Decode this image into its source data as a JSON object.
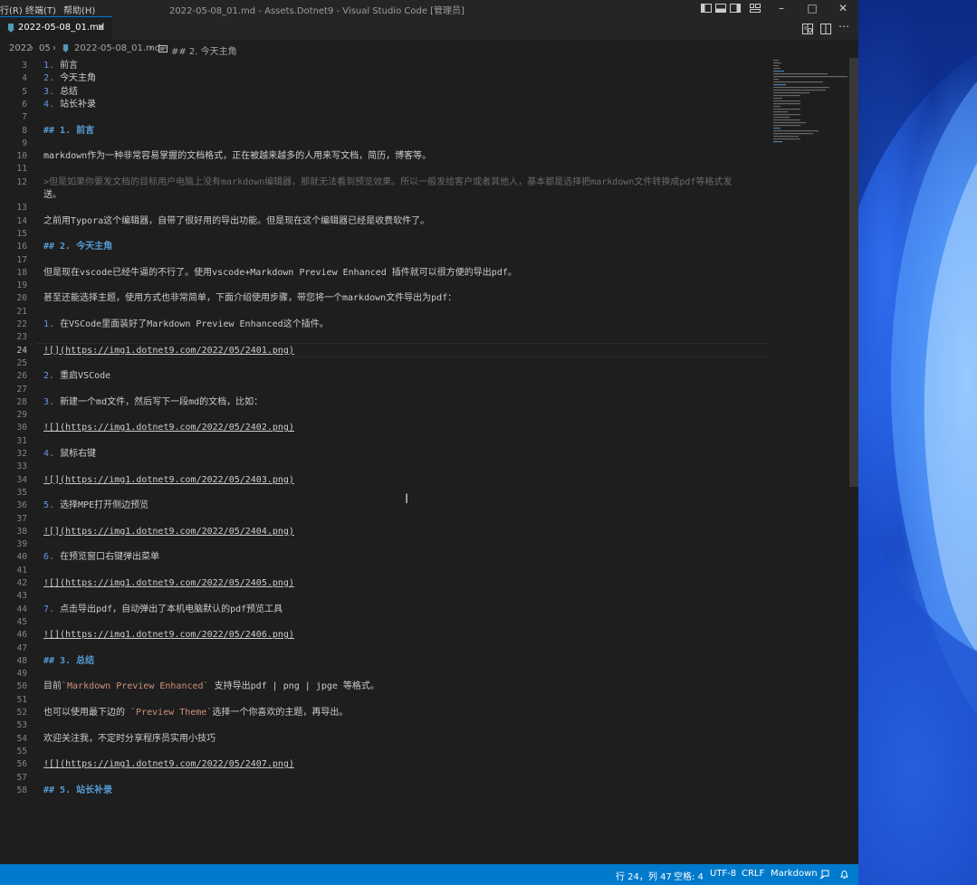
{
  "window": {
    "title": "2022-05-08_01.md - Assets.Dotnet9 - Visual Studio Code [管理员]",
    "menu": [
      "行(R)",
      "终端(T)",
      "帮助(H)"
    ]
  },
  "tab": {
    "label": "2022-05-08_01.md",
    "icon": "markdown-icon"
  },
  "breadcrumb": [
    "2022",
    "05",
    "2022-05-08_01.md",
    "## 2. 今天主角"
  ],
  "editor": {
    "current_line": 24,
    "lines": [
      {
        "n": "3",
        "t": "1. 前言"
      },
      {
        "n": "4",
        "t": "2. 今天主角"
      },
      {
        "n": "5",
        "t": "3. 总结"
      },
      {
        "n": "6",
        "t": "4. 站长补录"
      },
      {
        "n": "7",
        "t": ""
      },
      {
        "n": "8",
        "t": "## 1. 前言"
      },
      {
        "n": "9",
        "t": ""
      },
      {
        "n": "10",
        "t": "markdown作为一种非常容易掌握的文档格式，正在被越来越多的人用来写文档，简历，博客等。"
      },
      {
        "n": "11",
        "t": ""
      },
      {
        "n": "12",
        "t": ">但是如果你要发文档的目标用户电脑上没有markdown编辑器，那就无法看到预览效果。所以一般发给客户或者其他人，基本都是选择把markdown文件转换成pdf等格式发"
      },
      {
        "n": "",
        "t": "送。"
      },
      {
        "n": "13",
        "t": ""
      },
      {
        "n": "14",
        "t": "之前用Typora这个编辑器，自带了很好用的导出功能。但是现在这个编辑器已经是收费软件了。"
      },
      {
        "n": "15",
        "t": ""
      },
      {
        "n": "16",
        "t": "## 2. 今天主角"
      },
      {
        "n": "17",
        "t": ""
      },
      {
        "n": "18",
        "t": "但是现在vscode已经牛逼的不行了。使用vscode+Markdown Preview Enhanced 插件就可以很方便的导出pdf。"
      },
      {
        "n": "19",
        "t": ""
      },
      {
        "n": "20",
        "t": "甚至还能选择主题，使用方式也非常简单，下面介绍使用步骤，带您将一个markdown文件导出为pdf："
      },
      {
        "n": "21",
        "t": ""
      },
      {
        "n": "22",
        "t": "1. 在VSCode里面装好了Markdown Preview Enhanced这个插件。"
      },
      {
        "n": "23",
        "t": ""
      },
      {
        "n": "24",
        "t": "![](https://img1.dotnet9.com/2022/05/2401.png)"
      },
      {
        "n": "25",
        "t": ""
      },
      {
        "n": "26",
        "t": "2. 重启VSCode"
      },
      {
        "n": "27",
        "t": ""
      },
      {
        "n": "28",
        "t": "3. 新建一个md文件，然后写下一段md的文档，比如："
      },
      {
        "n": "29",
        "t": ""
      },
      {
        "n": "30",
        "t": "![](https://img1.dotnet9.com/2022/05/2402.png)"
      },
      {
        "n": "31",
        "t": ""
      },
      {
        "n": "32",
        "t": "4. 鼠标右键"
      },
      {
        "n": "33",
        "t": ""
      },
      {
        "n": "34",
        "t": "![](https://img1.dotnet9.com/2022/05/2403.png)"
      },
      {
        "n": "35",
        "t": ""
      },
      {
        "n": "36",
        "t": "5. 选择MPE打开侧边预览"
      },
      {
        "n": "37",
        "t": ""
      },
      {
        "n": "38",
        "t": "![](https://img1.dotnet9.com/2022/05/2404.png)"
      },
      {
        "n": "39",
        "t": ""
      },
      {
        "n": "40",
        "t": "6. 在预览窗口右键弹出菜单"
      },
      {
        "n": "41",
        "t": ""
      },
      {
        "n": "42",
        "t": "![](https://img1.dotnet9.com/2022/05/2405.png)"
      },
      {
        "n": "43",
        "t": ""
      },
      {
        "n": "44",
        "t": "7. 点击导出pdf，自动弹出了本机电脑默认的pdf预览工具"
      },
      {
        "n": "45",
        "t": ""
      },
      {
        "n": "46",
        "t": "![](https://img1.dotnet9.com/2022/05/2406.png)"
      },
      {
        "n": "47",
        "t": ""
      },
      {
        "n": "48",
        "t": "## 3. 总结"
      },
      {
        "n": "49",
        "t": ""
      },
      {
        "n": "50",
        "t": "目前`Markdown Preview Enhanced` 支持导出pdf | png | jpge 等格式。"
      },
      {
        "n": "51",
        "t": ""
      },
      {
        "n": "52",
        "t": "也可以使用最下边的 `Preview Theme`选择一个你喜欢的主题，再导出。"
      },
      {
        "n": "53",
        "t": ""
      },
      {
        "n": "54",
        "t": "欢迎关注我，不定时分享程序员实用小技巧"
      },
      {
        "n": "55",
        "t": ""
      },
      {
        "n": "56",
        "t": "![](https://img1.dotnet9.com/2022/05/2407.png)"
      },
      {
        "n": "57",
        "t": ""
      },
      {
        "n": "58",
        "t": "## 5. 站长补录"
      }
    ]
  },
  "statusbar": {
    "position": "行 24，列 47",
    "spaces": "空格: 4",
    "encoding": "UTF-8",
    "eol": "CRLF",
    "language": "Markdown"
  },
  "colors": {
    "accent": "#007acc",
    "heading": "#569cd6",
    "inline_code": "#ce9178"
  }
}
